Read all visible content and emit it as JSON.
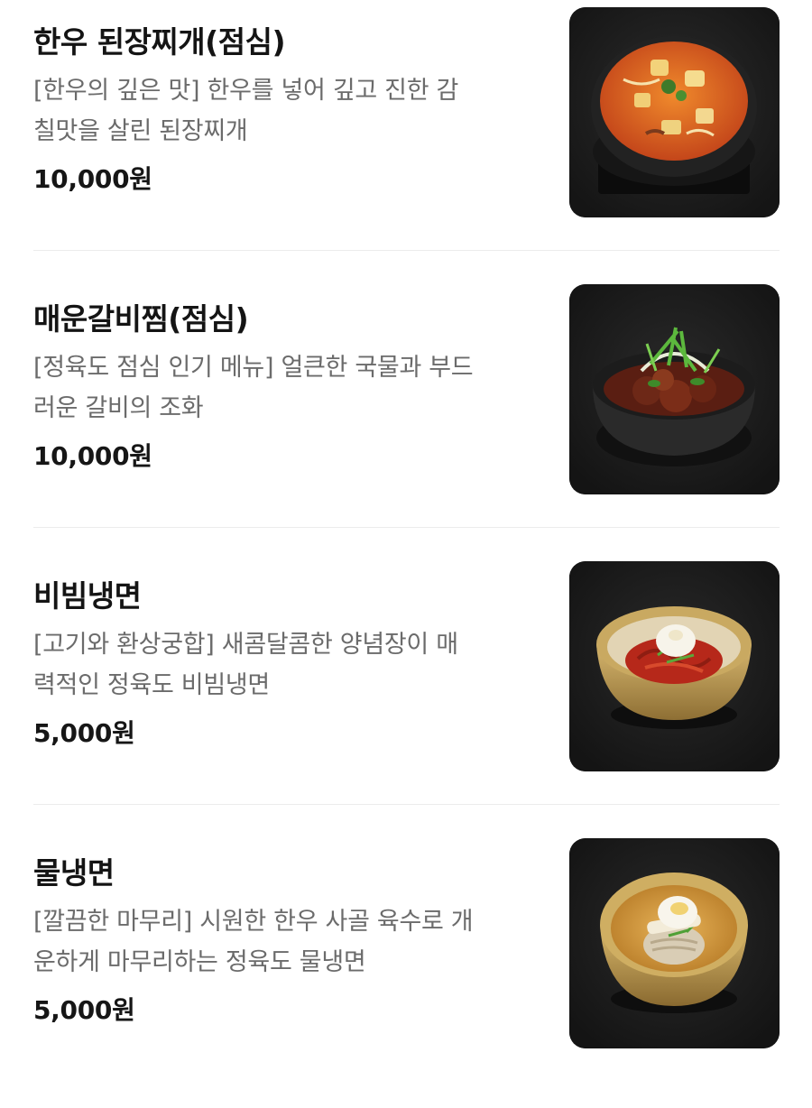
{
  "menu": {
    "items": [
      {
        "name": "한우 된장찌개(점심)",
        "desc_line1": "[한우의 깊은 맛] 한우를 넣어 깊고 진한 감",
        "desc_line2": "칠맛을 살린 된장찌개",
        "price": "10,000원",
        "photo_icon": "doenjang-jjigae-photo"
      },
      {
        "name": "매운갈비찜(점심)",
        "desc_line1": "[정육도 점심 인기 메뉴] 얼큰한 국물과 부드",
        "desc_line2": "러운 갈비의 조화",
        "price": "10,000원",
        "photo_icon": "spicy-galbi-jjim-photo"
      },
      {
        "name": "비빔냉면",
        "desc_line1": "[고기와 환상궁합] 새콤달콤한 양념장이 매",
        "desc_line2": "력적인 정육도 비빔냉면",
        "price": "5,000원",
        "photo_icon": "bibim-naengmyeon-photo"
      },
      {
        "name": "물냉면",
        "desc_line1": "[깔끔한 마무리] 시원한 한우 사골 육수로 개",
        "desc_line2": "운하게 마무리하는 정육도 물냉면",
        "price": "5,000원",
        "photo_icon": "mul-naengmyeon-photo"
      }
    ]
  },
  "colors": {
    "photo_background": "#1e1e1e",
    "title_text": "#141414",
    "desc_text": "#6b6b6b",
    "divider": "#ececec"
  }
}
